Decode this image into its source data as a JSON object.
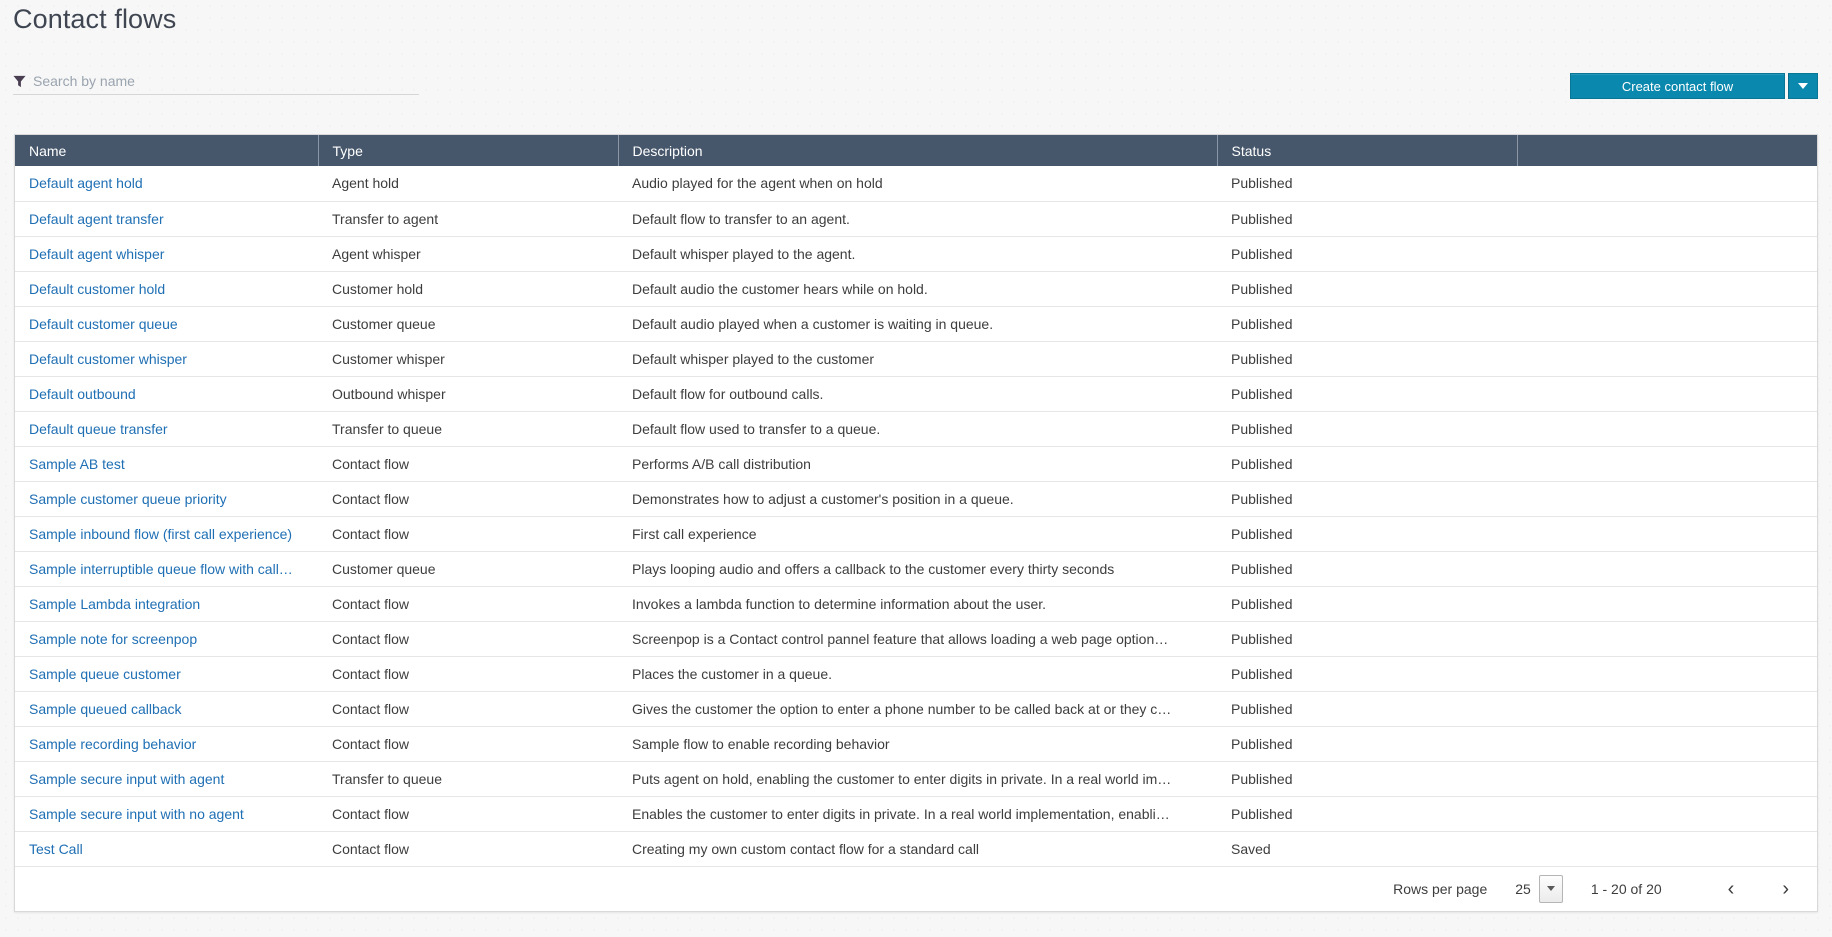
{
  "page": {
    "title": "Contact flows"
  },
  "search": {
    "placeholder": "Search by name",
    "value": "",
    "icon": "funnel-icon"
  },
  "actions": {
    "create_label": "Create contact flow",
    "dropdown_icon": "chevron-down-icon",
    "accent_color": "#0b88ad"
  },
  "table": {
    "header_bg": "#46566b",
    "link_color": "#1f6fb4",
    "columns": [
      "Name",
      "Type",
      "Description",
      "Status",
      ""
    ],
    "rows": [
      {
        "name": "Default agent hold",
        "type": "Agent hold",
        "description": "Audio played for the agent when on hold",
        "status": "Published"
      },
      {
        "name": "Default agent transfer",
        "type": "Transfer to agent",
        "description": "Default flow to transfer to an agent.",
        "status": "Published"
      },
      {
        "name": "Default agent whisper",
        "type": "Agent whisper",
        "description": "Default whisper played to the agent.",
        "status": "Published"
      },
      {
        "name": "Default customer hold",
        "type": "Customer hold",
        "description": "Default audio the customer hears while on hold.",
        "status": "Published"
      },
      {
        "name": "Default customer queue",
        "type": "Customer queue",
        "description": "Default audio played when a customer is waiting in queue.",
        "status": "Published"
      },
      {
        "name": "Default customer whisper",
        "type": "Customer whisper",
        "description": "Default whisper played to the customer",
        "status": "Published"
      },
      {
        "name": "Default outbound",
        "type": "Outbound whisper",
        "description": "Default flow for outbound calls.",
        "status": "Published"
      },
      {
        "name": "Default queue transfer",
        "type": "Transfer to queue",
        "description": "Default flow used to transfer to a queue.",
        "status": "Published"
      },
      {
        "name": "Sample AB test",
        "type": "Contact flow",
        "description": "Performs A/B call distribution",
        "status": "Published"
      },
      {
        "name": "Sample customer queue priority",
        "type": "Contact flow",
        "description": "Demonstrates how to adjust a customer's position in a queue.",
        "status": "Published"
      },
      {
        "name": "Sample inbound flow (first call experience)",
        "type": "Contact flow",
        "description": "First call experience",
        "status": "Published"
      },
      {
        "name": "Sample interruptible queue flow with call…",
        "type": "Customer queue",
        "description": "Plays looping audio and offers a callback to the customer every thirty seconds",
        "status": "Published"
      },
      {
        "name": "Sample Lambda integration",
        "type": "Contact flow",
        "description": "Invokes a lambda function to determine information about the user.",
        "status": "Published"
      },
      {
        "name": "Sample note for screenpop",
        "type": "Contact flow",
        "description": "Screenpop is a Contact control pannel feature that allows loading a web page option…",
        "status": "Published"
      },
      {
        "name": "Sample queue customer",
        "type": "Contact flow",
        "description": "Places the customer in a queue.",
        "status": "Published"
      },
      {
        "name": "Sample queued callback",
        "type": "Contact flow",
        "description": "Gives the customer the option to enter a phone number to be called back at or they c…",
        "status": "Published"
      },
      {
        "name": "Sample recording behavior",
        "type": "Contact flow",
        "description": "Sample flow to enable recording behavior",
        "status": "Published"
      },
      {
        "name": "Sample secure input with agent",
        "type": "Transfer to queue",
        "description": "Puts agent on hold, enabling the customer to enter digits in private. In a real world im…",
        "status": "Published"
      },
      {
        "name": "Sample secure input with no agent",
        "type": "Contact flow",
        "description": "Enables the customer to enter digits in private. In a real world implementation, enabli…",
        "status": "Published"
      },
      {
        "name": "Test Call",
        "type": "Contact flow",
        "description": "Creating my own custom contact flow for a standard call",
        "status": "Saved"
      }
    ]
  },
  "pagination": {
    "rows_per_page_label": "Rows per page",
    "rows_per_page_value": "25",
    "range_label": "1 - 20 of 20",
    "prev_icon": "chevron-left-icon",
    "next_icon": "chevron-right-icon",
    "prev_glyph": "‹",
    "next_glyph": "›"
  }
}
